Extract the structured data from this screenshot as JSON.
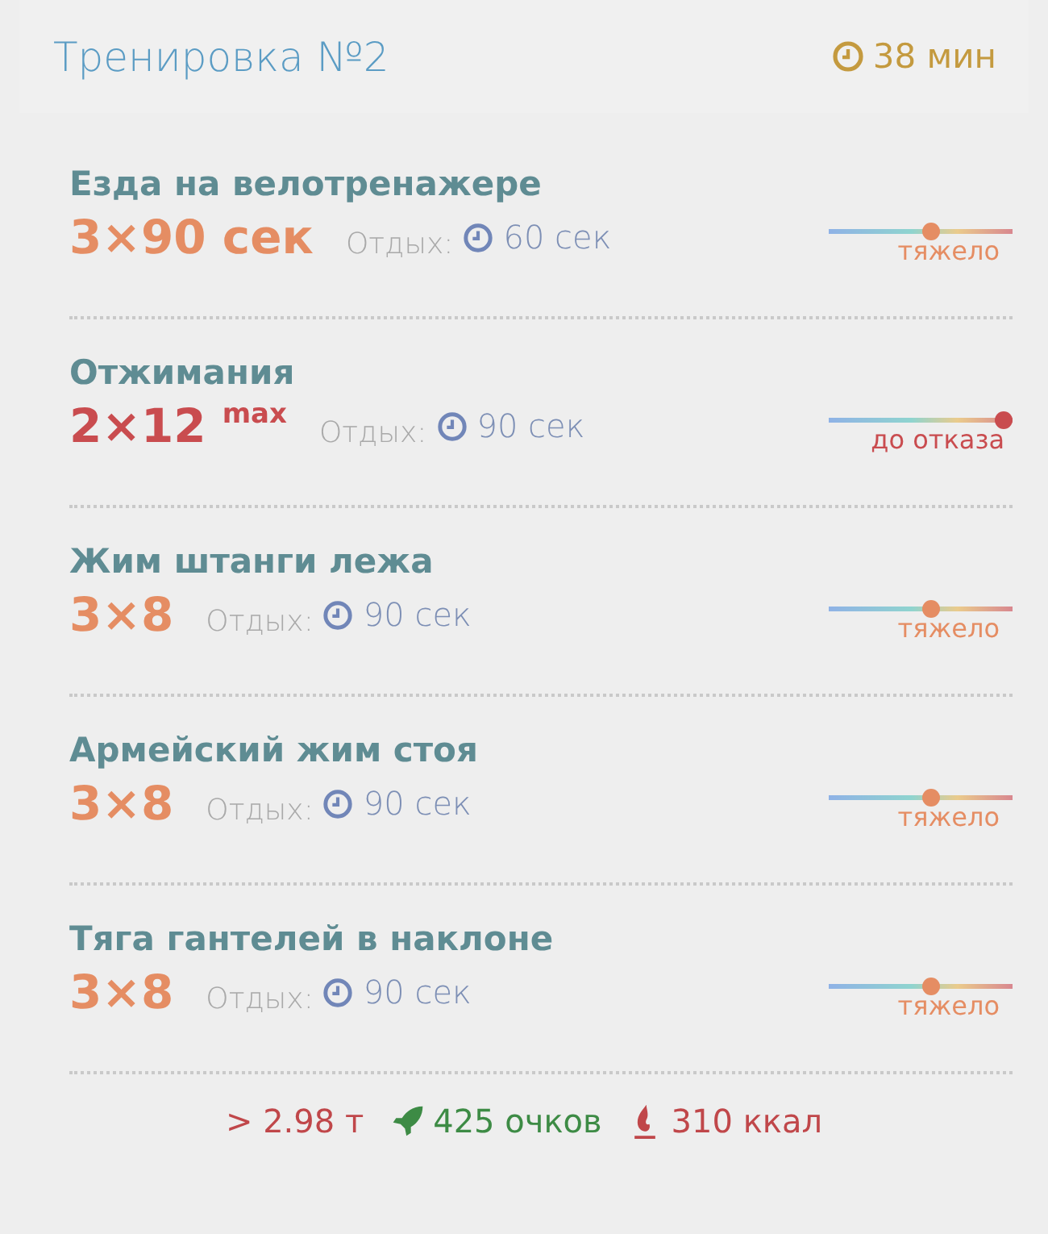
{
  "header": {
    "title": "Тренировка №2",
    "duration": "38 мин"
  },
  "exercises": [
    {
      "name": "Езда на велотренажере",
      "sets": "3×90 сек",
      "rest_label": "Отдых:",
      "rest": "60 сек",
      "kind": "heavy",
      "level": 0.55,
      "intensity": "тяжело"
    },
    {
      "name": "Отжимания",
      "sets": "2×12",
      "sets_note": "max",
      "rest_label": "Отдых:",
      "rest": "90 сек",
      "kind": "failure",
      "level": 1,
      "intensity": "до отказа"
    },
    {
      "name": "Жим штанги лежа",
      "sets": "3×8",
      "rest_label": "Отдых:",
      "rest": "90 сек",
      "kind": "heavy",
      "level": 0.55,
      "intensity": "тяжело"
    },
    {
      "name": "Армейский жим стоя",
      "sets": "3×8",
      "rest_label": "Отдых:",
      "rest": "90 сек",
      "kind": "heavy",
      "level": 0.55,
      "intensity": "тяжело"
    },
    {
      "name": "Тяга гантелей в наклоне",
      "sets": "3×8",
      "rest_label": "Отдых:",
      "rest": "90 сек",
      "kind": "heavy",
      "level": 0.55,
      "intensity": "тяжело"
    }
  ],
  "summary": {
    "tonnage": "> 2.98 т",
    "points": "425 очков",
    "calories": "310 ккал"
  }
}
